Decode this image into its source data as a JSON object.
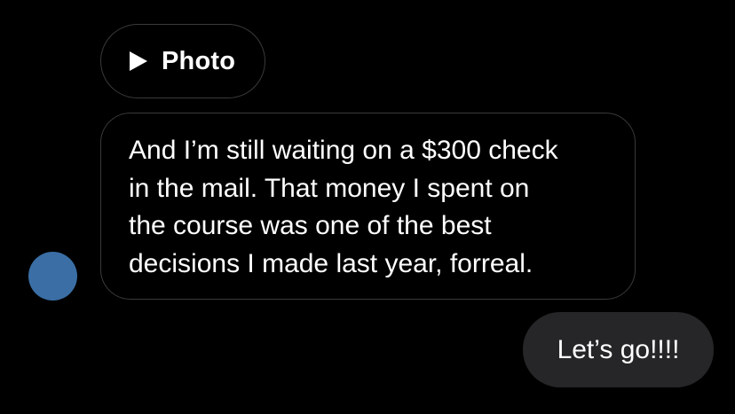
{
  "thread": {
    "photo_attachment": {
      "icon": "play-icon",
      "label": "Photo"
    },
    "incoming_message": {
      "text": "And I’m still waiting on a $300 check\nin the mail. That money I spent on\nthe course was one of the best\ndecisions I made last year, forreal."
    },
    "avatar": {
      "color": "#3a6ea5"
    },
    "outgoing_message": {
      "text": "Let’s go!!!!"
    }
  },
  "colors": {
    "background": "#000000",
    "incoming_border": "#3a3a3c",
    "outgoing_bubble": "#262628",
    "text": "#ffffff"
  }
}
